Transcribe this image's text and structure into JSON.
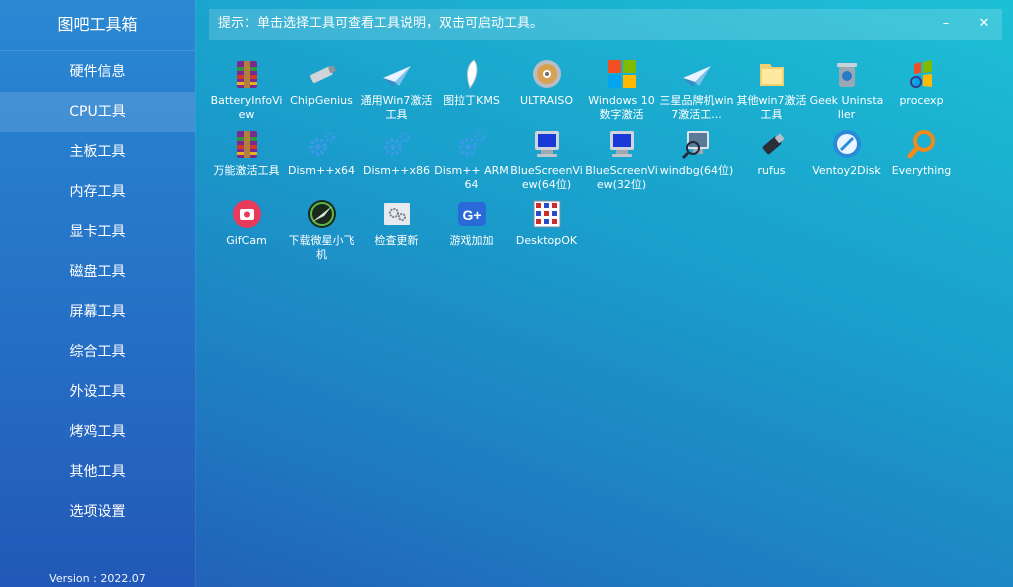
{
  "app": {
    "title": "图吧工具箱",
    "version": "Version : 2022.07"
  },
  "hint": {
    "text": "提示：单击选择工具可查看工具说明，双击可启动工具。",
    "minimize": "–",
    "close": "✕"
  },
  "sidebar": {
    "active_index": 1,
    "items": [
      {
        "label": "硬件信息"
      },
      {
        "label": "CPU工具"
      },
      {
        "label": "主板工具"
      },
      {
        "label": "内存工具"
      },
      {
        "label": "显卡工具"
      },
      {
        "label": "磁盘工具"
      },
      {
        "label": "屏幕工具"
      },
      {
        "label": "综合工具"
      },
      {
        "label": "外设工具"
      },
      {
        "label": "烤鸡工具"
      },
      {
        "label": "其他工具"
      },
      {
        "label": "选项设置"
      }
    ]
  },
  "tools": [
    {
      "label": "BatteryInfoView",
      "icon": "winrar-icon"
    },
    {
      "label": "ChipGenius",
      "icon": "usb-stick-icon"
    },
    {
      "label": "通用Win7激活工具",
      "icon": "paper-plane-icon"
    },
    {
      "label": "图拉丁KMS",
      "icon": "feather-icon"
    },
    {
      "label": "ULTRAISO",
      "icon": "disc-icon"
    },
    {
      "label": "Windows 10数字激活",
      "icon": "windows-logo-icon"
    },
    {
      "label": "三星品牌机win7激活工...",
      "icon": "paper-plane-icon"
    },
    {
      "label": "其他win7激活工具",
      "icon": "folder-icon"
    },
    {
      "label": "Geek Uninstaller",
      "icon": "trash-can-icon"
    },
    {
      "label": "procexp",
      "icon": "windows-flag-icon"
    },
    {
      "label": "万能激活工具",
      "icon": "winrar-icon"
    },
    {
      "label": "Dism++x64",
      "icon": "gears-icon"
    },
    {
      "label": "Dism++x86",
      "icon": "gears-icon"
    },
    {
      "label": "Dism++ ARM64",
      "icon": "gears-icon"
    },
    {
      "label": "BlueScreenView(64位)",
      "icon": "monitor-icon"
    },
    {
      "label": "BlueScreenView(32位)",
      "icon": "monitor-icon"
    },
    {
      "label": "windbg(64位)",
      "icon": "debugger-icon"
    },
    {
      "label": "rufus",
      "icon": "usb-drive-icon"
    },
    {
      "label": "Ventoy2Disk",
      "icon": "ventoy-icon"
    },
    {
      "label": "Everything",
      "icon": "magnifier-icon"
    },
    {
      "label": "GifCam",
      "icon": "camera-icon"
    },
    {
      "label": "下载微星小飞机",
      "icon": "msi-afterburner-icon"
    },
    {
      "label": "检查更新",
      "icon": "update-gear-icon"
    },
    {
      "label": "游戏加加",
      "icon": "gplus-icon"
    },
    {
      "label": "DesktopOK",
      "icon": "desktop-grid-icon"
    }
  ],
  "colors": {
    "accent": "#2a88d3",
    "background": "#1a9ecb"
  }
}
